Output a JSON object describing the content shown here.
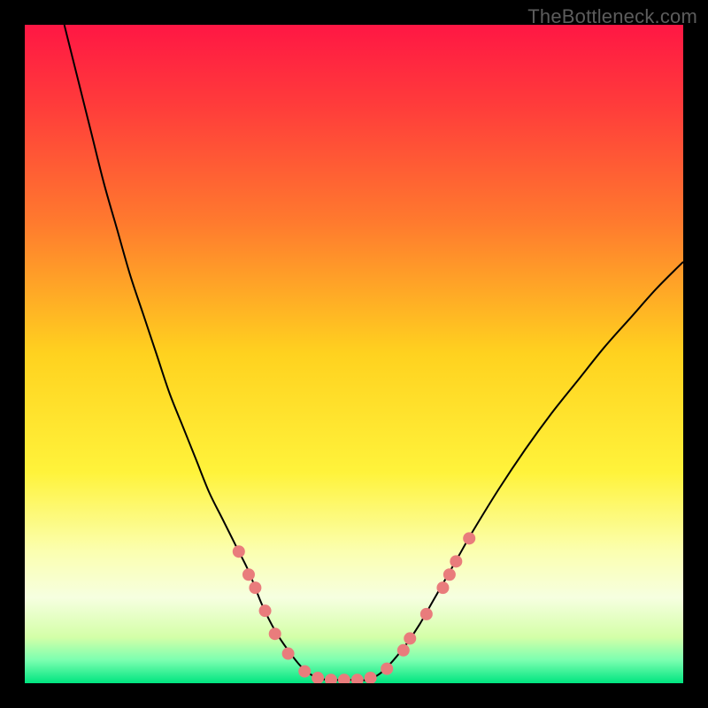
{
  "watermark": "TheBottleneck.com",
  "chart_data": {
    "type": "line",
    "title": "",
    "xlabel": "",
    "ylabel": "",
    "xlim": [
      0,
      100
    ],
    "ylim": [
      0,
      100
    ],
    "grid": false,
    "legend": false,
    "gradient_stops": [
      {
        "offset": 0.0,
        "color": "#ff1744"
      },
      {
        "offset": 0.12,
        "color": "#ff3b3b"
      },
      {
        "offset": 0.3,
        "color": "#ff7a2e"
      },
      {
        "offset": 0.5,
        "color": "#ffd21f"
      },
      {
        "offset": 0.68,
        "color": "#fff33b"
      },
      {
        "offset": 0.8,
        "color": "#fbffb0"
      },
      {
        "offset": 0.87,
        "color": "#f6ffe0"
      },
      {
        "offset": 0.93,
        "color": "#d4ffa8"
      },
      {
        "offset": 0.965,
        "color": "#7bffb0"
      },
      {
        "offset": 1.0,
        "color": "#00e580"
      }
    ],
    "curve": {
      "name": "bottleneck-curve",
      "color": "#000000",
      "width": 2,
      "x": [
        6,
        8,
        10,
        12,
        14,
        16,
        18,
        20,
        22,
        24,
        26,
        28,
        30,
        32,
        34,
        36,
        38,
        40,
        42,
        44,
        46,
        48,
        50,
        52,
        54,
        56,
        58,
        60,
        62,
        64,
        66,
        68,
        72,
        76,
        80,
        84,
        88,
        92,
        96,
        100
      ],
      "y": [
        100,
        92,
        84,
        76,
        69,
        62,
        56,
        50,
        44,
        39,
        34,
        29,
        25,
        21,
        17,
        12,
        8,
        5,
        2.5,
        1,
        0.5,
        0.5,
        0.5,
        0.5,
        1.5,
        3.5,
        6,
        9,
        12.5,
        16,
        19.5,
        23,
        29.5,
        35.5,
        41,
        46,
        51,
        55.5,
        60,
        64
      ]
    },
    "points": {
      "name": "highlight-points",
      "color": "#e97c7c",
      "radius": 7,
      "data": [
        {
          "x": 32.5,
          "y": 20
        },
        {
          "x": 34,
          "y": 16.5
        },
        {
          "x": 35,
          "y": 14.5
        },
        {
          "x": 36.5,
          "y": 11
        },
        {
          "x": 38,
          "y": 7.5
        },
        {
          "x": 40,
          "y": 4.5
        },
        {
          "x": 42.5,
          "y": 1.8
        },
        {
          "x": 44.5,
          "y": 0.8
        },
        {
          "x": 46.5,
          "y": 0.5
        },
        {
          "x": 48.5,
          "y": 0.5
        },
        {
          "x": 50.5,
          "y": 0.5
        },
        {
          "x": 52.5,
          "y": 0.8
        },
        {
          "x": 55,
          "y": 2.2
        },
        {
          "x": 57.5,
          "y": 5
        },
        {
          "x": 58.5,
          "y": 6.8
        },
        {
          "x": 61,
          "y": 10.5
        },
        {
          "x": 63.5,
          "y": 14.5
        },
        {
          "x": 64.5,
          "y": 16.5
        },
        {
          "x": 65.5,
          "y": 18.5
        },
        {
          "x": 67.5,
          "y": 22
        }
      ]
    }
  }
}
